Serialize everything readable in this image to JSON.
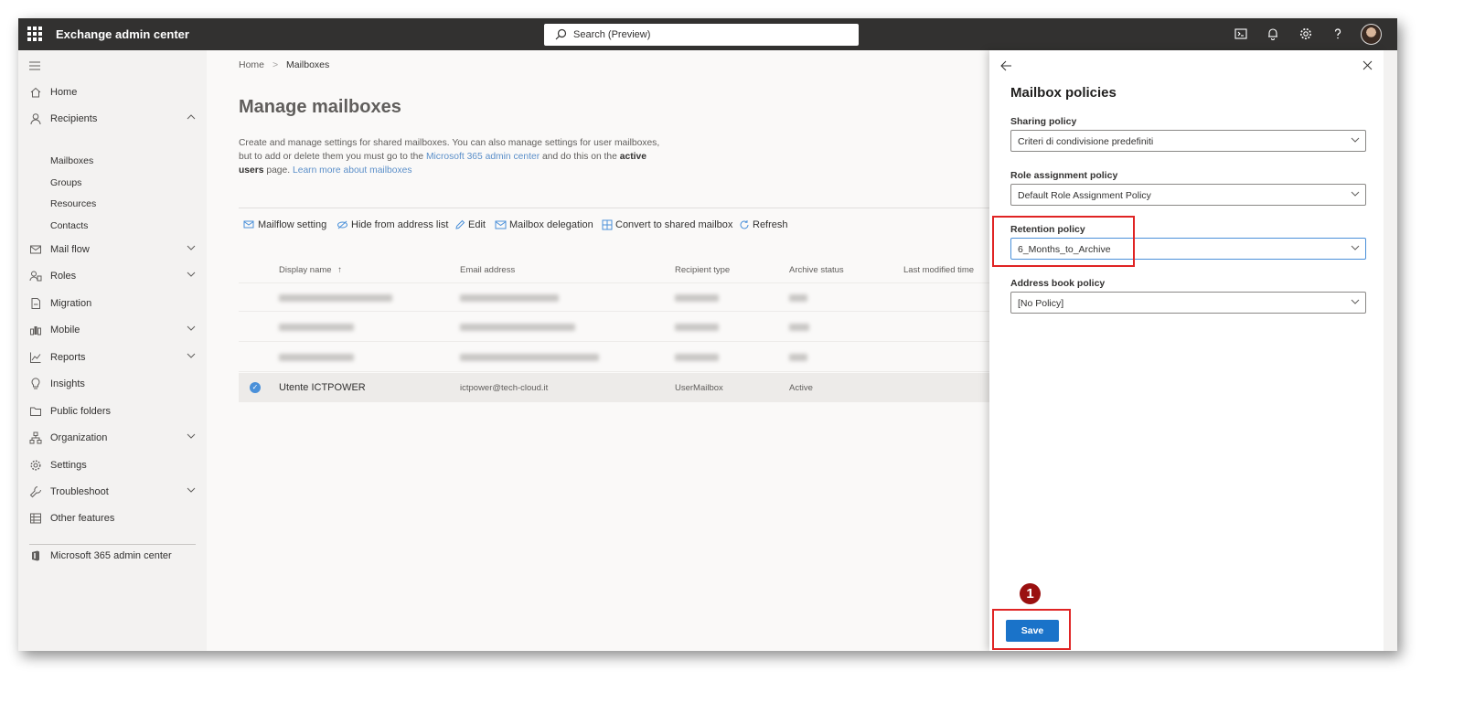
{
  "app": {
    "title": "Exchange admin center"
  },
  "search": {
    "placeholder": "Search (Preview)"
  },
  "sidebar": {
    "items": [
      {
        "label": "Home"
      },
      {
        "label": "Recipients"
      },
      {
        "label": "Mail flow"
      },
      {
        "label": "Roles"
      },
      {
        "label": "Migration"
      },
      {
        "label": "Mobile"
      },
      {
        "label": "Reports"
      },
      {
        "label": "Insights"
      },
      {
        "label": "Public folders"
      },
      {
        "label": "Organization"
      },
      {
        "label": "Settings"
      },
      {
        "label": "Troubleshoot"
      },
      {
        "label": "Other features"
      }
    ],
    "recipients_sub": [
      "Mailboxes",
      "Groups",
      "Resources",
      "Contacts"
    ],
    "footer_link": "Microsoft 365 admin center"
  },
  "breadcrumb": {
    "home": "Home",
    "current": "Mailboxes",
    "separator": ">"
  },
  "page": {
    "title": "Manage mailboxes",
    "desc_part1": "Create and manage settings for shared mailboxes. You can also manage settings for user mailboxes, but to add or delete them you must go to the ",
    "desc_link1": "Microsoft 365 admin center",
    "desc_part2": " and do this on the ",
    "desc_bold": "active users",
    "desc_part3": " page. ",
    "desc_link2": "Learn more about mailboxes"
  },
  "commands": [
    {
      "label": "Mailflow setting"
    },
    {
      "label": "Hide from address list"
    },
    {
      "label": "Edit"
    },
    {
      "label": "Mailbox delegation"
    },
    {
      "label": "Convert to shared mailbox"
    },
    {
      "label": "Refresh"
    }
  ],
  "table": {
    "columns": [
      "Display name",
      "Email address",
      "Recipient type",
      "Archive status",
      "Last modified time"
    ],
    "sort_indicator": "↑",
    "selected_row": {
      "display_name": "Utente ICTPOWER",
      "email": "ictpower@tech-cloud.it",
      "recipient_type": "UserMailbox",
      "archive_status": "Active"
    }
  },
  "panel": {
    "title": "Mailbox policies",
    "fields": [
      {
        "label": "Sharing policy",
        "value": "Criteri di condivisione predefiniti"
      },
      {
        "label": "Role assignment policy",
        "value": "Default Role Assignment Policy"
      },
      {
        "label": "Retention policy",
        "value": "6_Months_to_Archive"
      },
      {
        "label": "Address book policy",
        "value": "[No Policy]"
      }
    ],
    "save_label": "Save"
  },
  "annotation": {
    "step": "1",
    "highlight_color": "#e02424"
  },
  "colors": {
    "topbar": "#323130",
    "accent": "#1a73c9",
    "link": "#5b8fc9",
    "sidebar": "#f3f2f1"
  }
}
